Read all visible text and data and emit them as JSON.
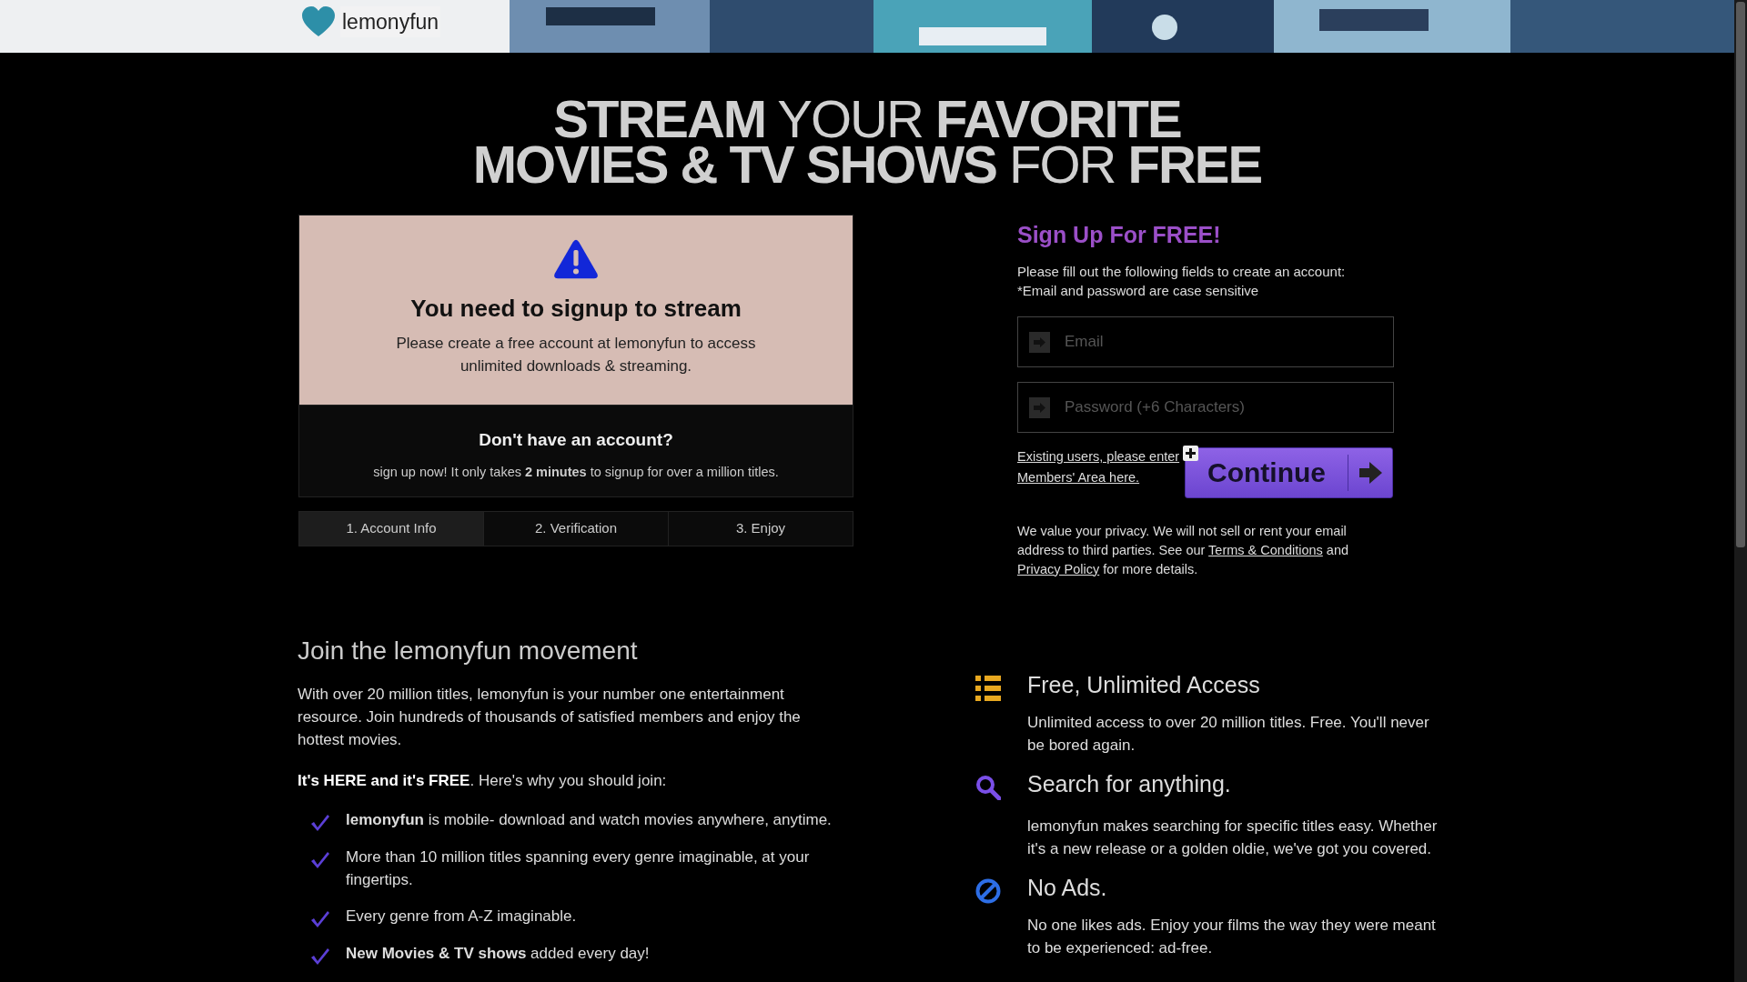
{
  "header": {
    "logo": "lemonyfun"
  },
  "headline": {
    "line_1": "**STREAM** YOUR **FAVORITE**",
    "line_2": "**MOVIES & TV SHOWS** FOR **FREE**"
  },
  "notice": {
    "title": "You need to signup to stream",
    "message": "Please create a free account at lemonyfun to access unlimited downloads & streaming."
  },
  "account_prompt": {
    "title": "Don't have an account?",
    "text": "sign up now! It only takes **2 minutes** to signup for over a million titles."
  },
  "steps": [
    {
      "label": "1. Account Info",
      "selected": true
    },
    {
      "label": "2. Verification",
      "selected": false
    },
    {
      "label": "3. Enjoy",
      "selected": false
    }
  ],
  "signup": {
    "title": "Sign Up For FREE!",
    "instructions": [
      "Please fill out the following fields to create an account:",
      "*Email and password are case sensitive"
    ],
    "fields": [
      {
        "placeholder": "Email"
      },
      {
        "placeholder": "Password (+6 Characters)"
      }
    ],
    "members_link": "Existing users, please enter Members' Area here.",
    "continue_button": "Continue",
    "privacy": {
      "text_before": "We value your privacy. We will not sell or rent your email address to third parties. See our",
      "terms_link": "Terms & Conditions",
      "text_middle": "and",
      "policy_link": "Privacy Policy",
      "text_after": "for more details."
    }
  },
  "about": {
    "title": "Join the lemonyfun movement",
    "intro": "With over 20 million titles, lemonyfun is your number one entertainment resource. Join hundreds of thousands of satisfied members and enjoy the hottest movies.",
    "lead": "**It's HERE and it's FREE**. Here's why you should join:",
    "benefits": [
      "**lemonyfun** is mobile- download and watch movies anywhere, anytime.",
      "More than 10 million titles spanning every genre imaginable, at your fingertips.",
      "Every genre from A-Z imaginable.",
      "**New Movies & TV shows** added every day!"
    ]
  },
  "features": [
    {
      "kind": "list",
      "title": "Free, Unlimited Access",
      "text": "Unlimited access to over 20 million titles. Free. You'll never be bored again."
    },
    {
      "kind": "search",
      "title": "Search for anything.",
      "text": "lemonyfun makes searching for specific titles easy. Whether it's a new release or a golden oldie, we've got you covered."
    },
    {
      "kind": "no-ads",
      "title": "No Ads.",
      "text": "No one likes ads. Enjoy your films the way they were meant to be experienced: ad-free."
    }
  ]
}
